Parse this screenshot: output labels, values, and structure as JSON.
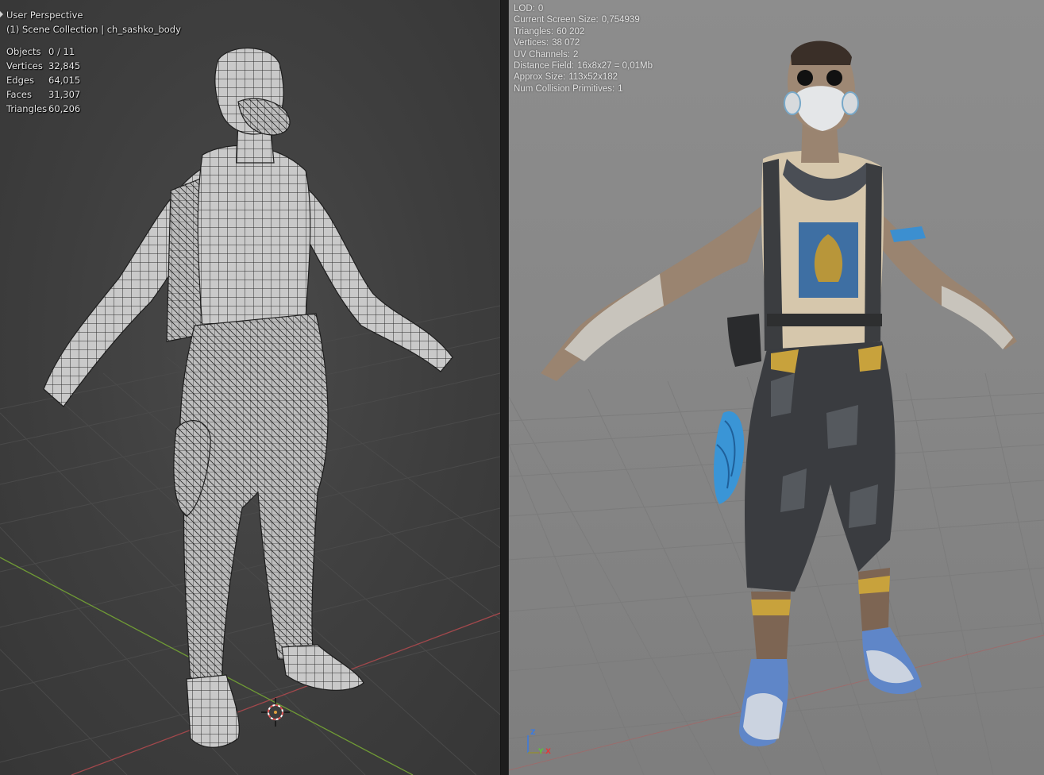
{
  "blender": {
    "view_name": "User Perspective",
    "collection_info": "(1) Scene Collection | ch_sashko_body",
    "stats": [
      {
        "label": "Objects",
        "value": "0 / 11"
      },
      {
        "label": "Vertices",
        "value": "32,845"
      },
      {
        "label": "Edges",
        "value": "64,015"
      },
      {
        "label": "Faces",
        "value": "31,307"
      },
      {
        "label": "Triangles",
        "value": "60,206"
      }
    ],
    "grid_axis_x_color": "#a2484c",
    "grid_axis_y_color": "#6f9a35",
    "cursor_icon": "3d-cursor-icon"
  },
  "unreal": {
    "stats": [
      {
        "label": "LOD:",
        "value": "0"
      },
      {
        "label": "Current Screen Size:",
        "value": "0,754939"
      },
      {
        "label": "Triangles:",
        "value": "60 202"
      },
      {
        "label": "Vertices:",
        "value": "38 072"
      },
      {
        "label": "UV Channels:",
        "value": "2"
      },
      {
        "label": "Distance Field:",
        "value": "16x8x27 = 0,01Mb"
      },
      {
        "label": "Approx Size:",
        "value": "113x52x182"
      },
      {
        "label": "Num Collision Primitives:",
        "value": "1"
      }
    ],
    "axis_icon": "axis-gizmo-icon",
    "axis_labels": {
      "z": "Z",
      "y": "Y",
      "x": "X"
    },
    "axis_colors": {
      "x": "#e03a3a",
      "y": "#5cc43a",
      "z": "#3a7ae0"
    }
  }
}
